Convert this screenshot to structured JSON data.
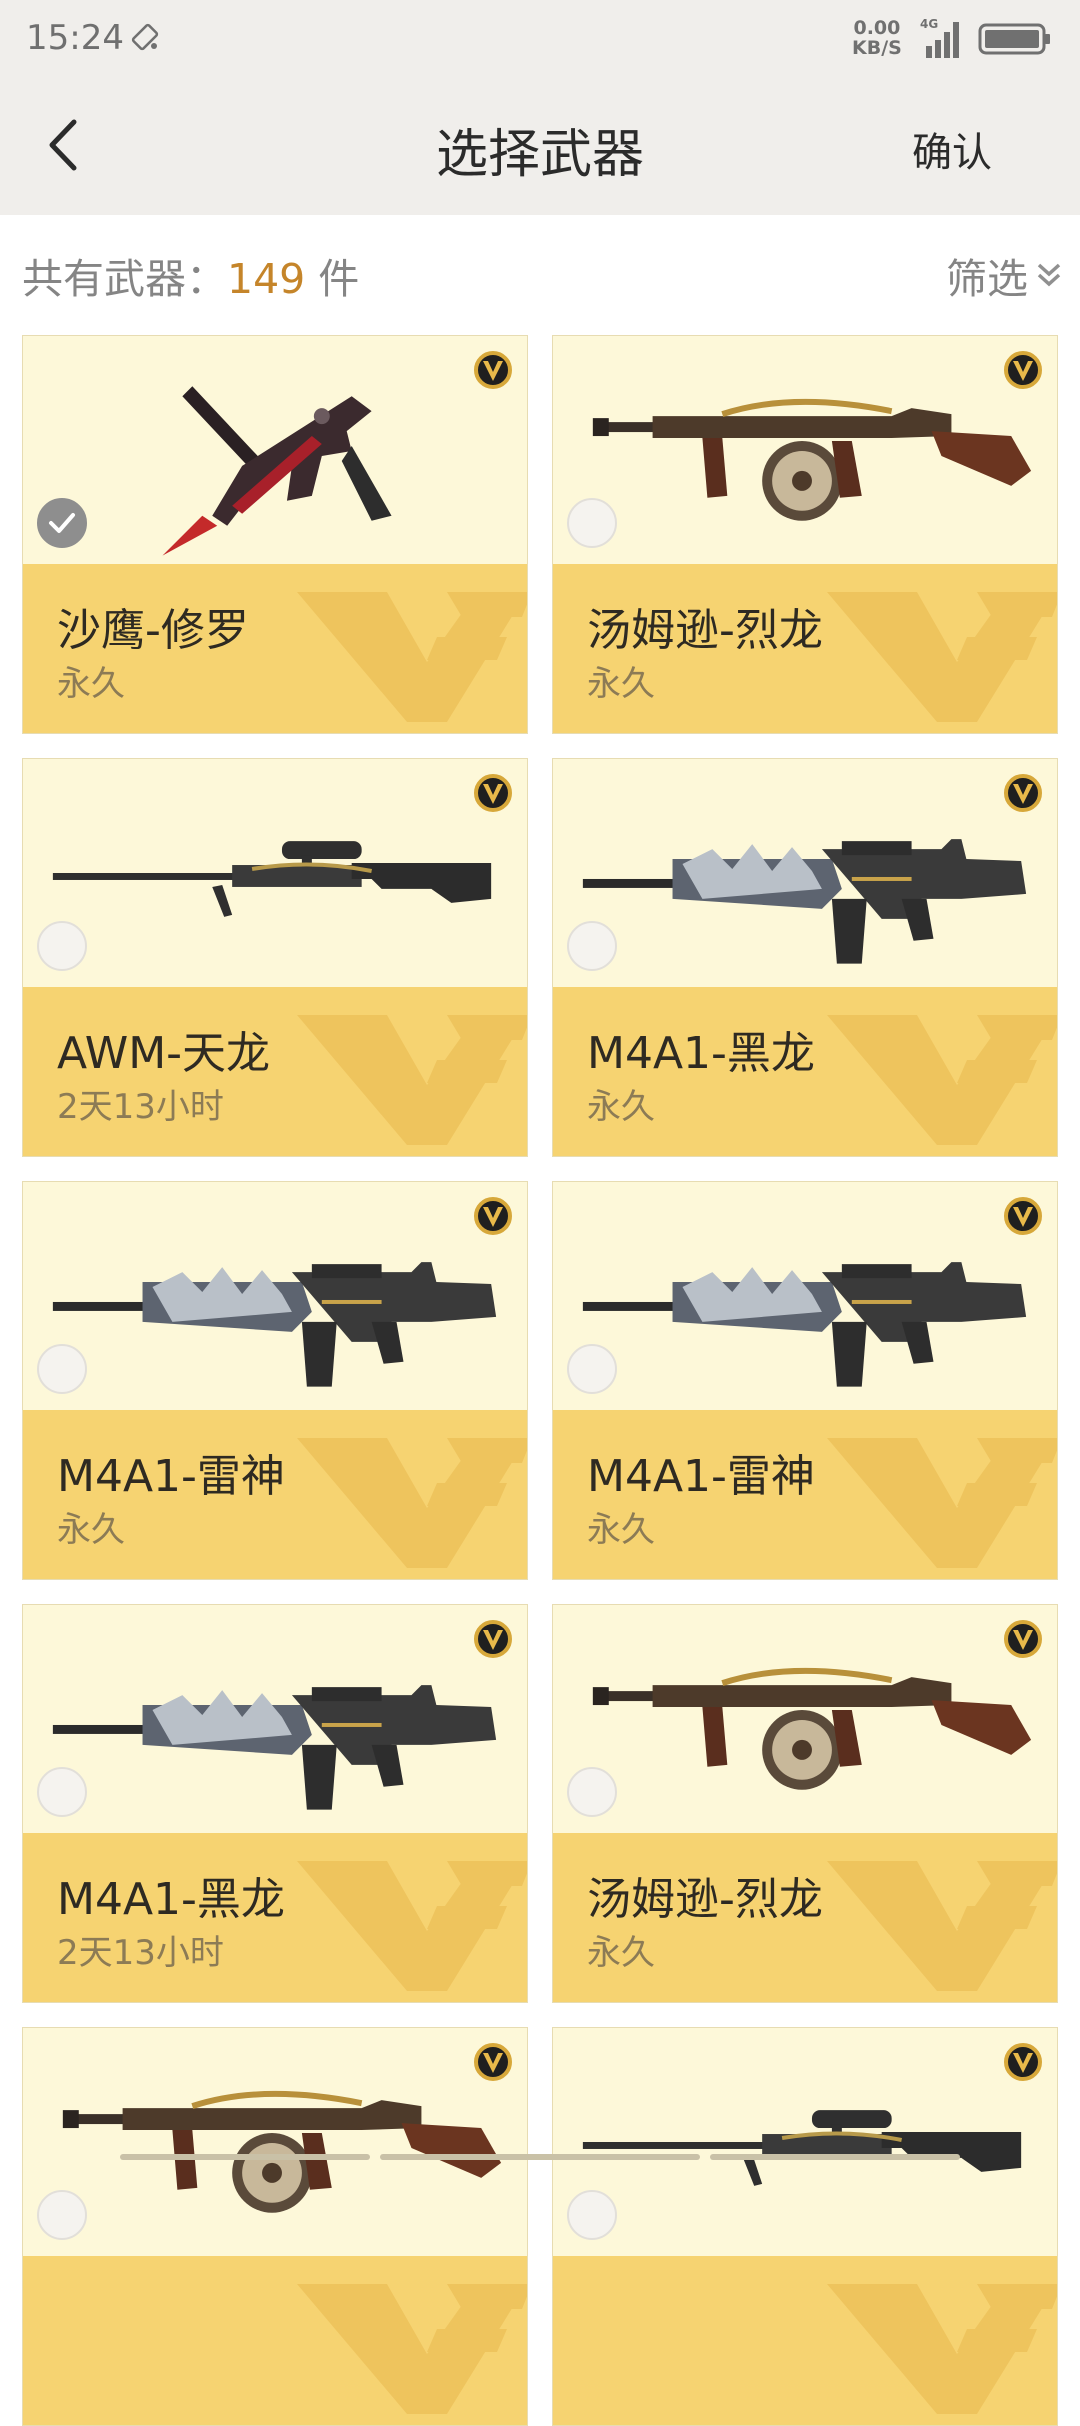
{
  "status": {
    "time": "15:24",
    "speed_value": "0.00",
    "speed_unit": "KB/S",
    "network": "4G"
  },
  "nav": {
    "title": "选择武器",
    "confirm_label": "确认"
  },
  "summary": {
    "label": "共有武器：",
    "count": "149",
    "unit": " 件",
    "filter_label": "筛选"
  },
  "colors": {
    "accent": "#c5852a",
    "card_top": "#fdf8d9",
    "card_bottom": "#f6d371"
  },
  "items": [
    {
      "name": "沙鹰-修罗",
      "duration": "永久",
      "selected": true,
      "icon": "pistol-icon"
    },
    {
      "name": "汤姆逊-烈龙",
      "duration": "永久",
      "selected": false,
      "icon": "smg-icon"
    },
    {
      "name": "AWM-天龙",
      "duration": "2天13小时",
      "selected": false,
      "icon": "sniper-icon"
    },
    {
      "name": "M4A1-黑龙",
      "duration": "永久",
      "selected": false,
      "icon": "rifle-icon"
    },
    {
      "name": "M4A1-雷神",
      "duration": "永久",
      "selected": false,
      "icon": "rifle-icon"
    },
    {
      "name": "M4A1-雷神",
      "duration": "永久",
      "selected": false,
      "icon": "rifle-icon"
    },
    {
      "name": "M4A1-黑龙",
      "duration": "2天13小时",
      "selected": false,
      "icon": "rifle-icon"
    },
    {
      "name": "汤姆逊-烈龙",
      "duration": "永久",
      "selected": false,
      "icon": "smg-icon"
    },
    {
      "name": "",
      "duration": "",
      "selected": false,
      "icon": "smg-icon"
    },
    {
      "name": "",
      "duration": "",
      "selected": false,
      "icon": "sniper-icon"
    }
  ]
}
